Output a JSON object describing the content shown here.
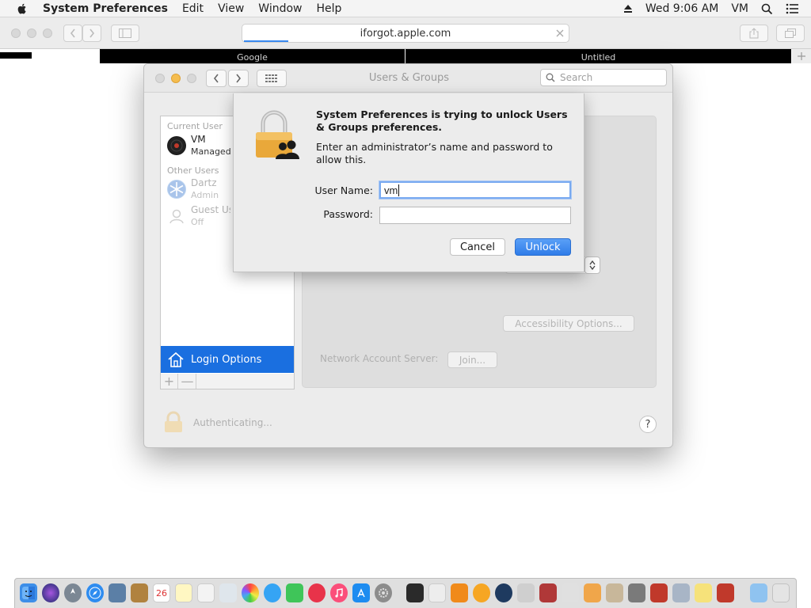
{
  "menubar": {
    "app_name": "System Preferences",
    "items": [
      "Edit",
      "View",
      "Window",
      "Help"
    ],
    "clock": "Wed 9:06 AM",
    "user": "VM"
  },
  "safari": {
    "url": "iforgot.apple.com",
    "tabs": [
      "Google",
      "Untitled"
    ]
  },
  "window": {
    "title": "Users & Groups",
    "search_placeholder": "Search",
    "current_user_label": "Current User",
    "current_user": {
      "name": "VM",
      "role": "Managed"
    },
    "other_users_label": "Other Users",
    "other_users": [
      {
        "name": "Dartz",
        "role": "Admin"
      },
      {
        "name": "Guest User",
        "role": "Off"
      }
    ],
    "login_options_label": "Login Options",
    "add_label": "+",
    "remove_label": "—",
    "accessibility_button": "Accessibility Options...",
    "network_label": "Network Account Server:",
    "join_button": "Join...",
    "authenticating": "Authenticating...",
    "help": "?"
  },
  "sheet": {
    "title": "System Preferences is trying to unlock Users & Groups preferences.",
    "message": "Enter an administrator’s name and password to allow this.",
    "username_label": "User Name:",
    "username_value": "vm",
    "password_label": "Password:",
    "password_value": "",
    "cancel": "Cancel",
    "unlock": "Unlock"
  },
  "dock": {
    "calendar_day": "26"
  },
  "colors": {
    "accent": "#1a6fe0",
    "unlock_button": "#2f7ce8",
    "lock_gold": "#e9a83a"
  }
}
